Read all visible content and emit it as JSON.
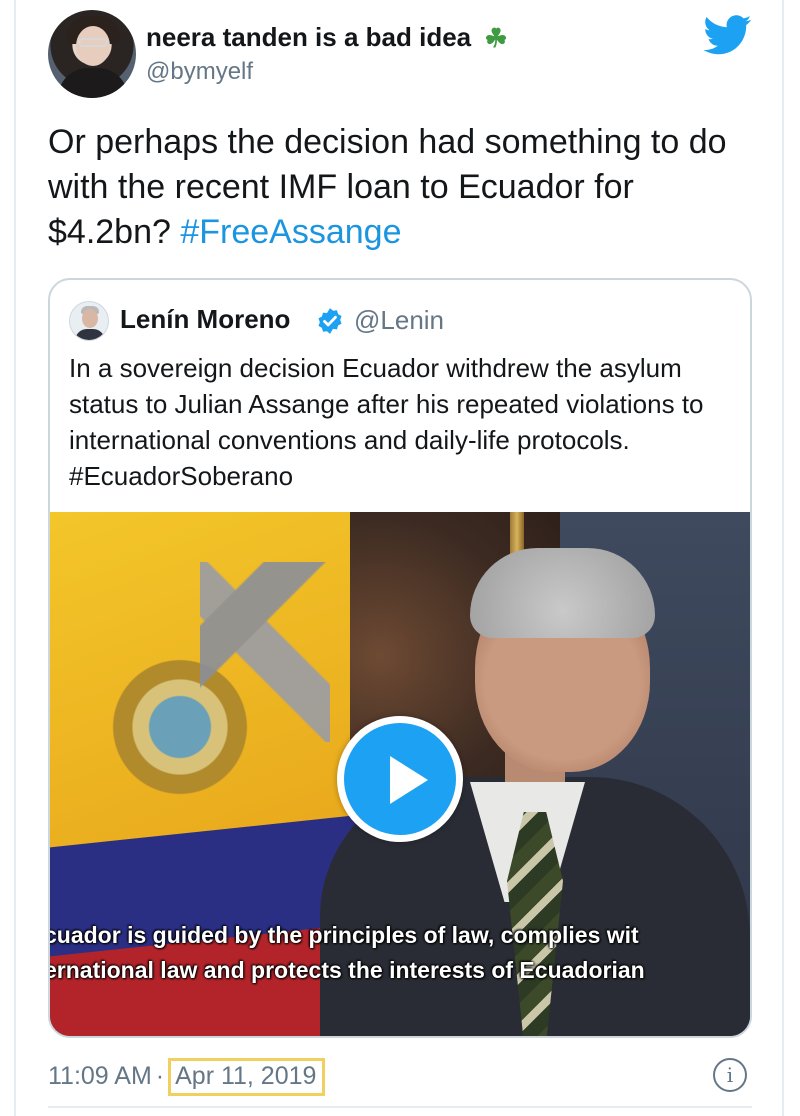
{
  "tweet": {
    "author_name": "neera tanden is a bad idea",
    "author_emoji": "☘",
    "author_handle": "@bymyelf",
    "text_prefix": "Or perhaps the decision had something to do with the recent IMF loan to Ecuador for $4.2bn? ",
    "hashtag": "#FreeAssange",
    "time": "11:09 AM",
    "separator": "·",
    "date": "Apr 11, 2019",
    "info_glyph": "i"
  },
  "quoted_tweet": {
    "author_name": "Lenín Moreno",
    "author_handle": "@Lenin",
    "text": "In a sovereign decision Ecuador withdrew the asylum status to Julian Assange after his repeated violations to international conventions and daily-life protocols. #EcuadorSoberano",
    "video": {
      "subtitle_line1": "cuador is guided by the principles of law, complies wit",
      "subtitle_line2": "ernational law and protects the interests of Ecuadorian"
    }
  },
  "colors": {
    "link_blue": "#1b95e0",
    "twitter_blue": "#1da1f2",
    "date_highlight": "#f2d060",
    "clover_green": "#3e9b41"
  }
}
